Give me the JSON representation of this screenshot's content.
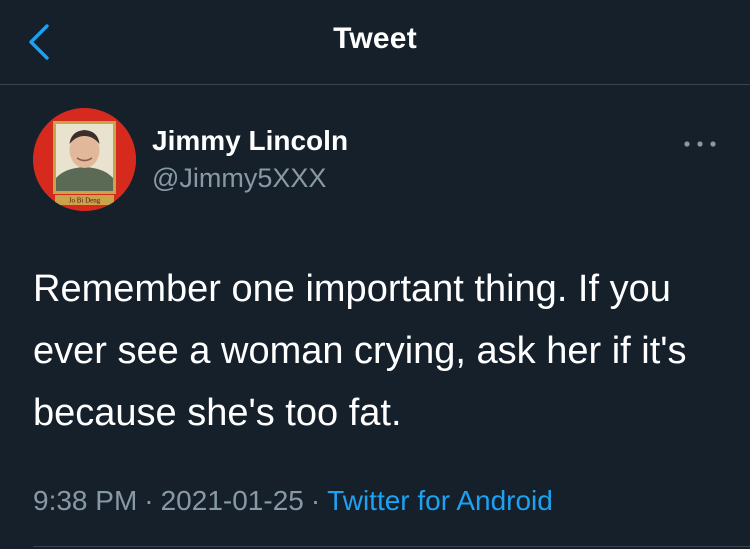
{
  "header": {
    "title": "Tweet",
    "back_icon": "chevron-left-icon"
  },
  "tweet": {
    "author": {
      "display_name": "Jimmy Lincoln",
      "handle": "@Jimmy5XXX",
      "avatar_caption": "Jo Bi Deng"
    },
    "text": "Remember one important thing. If you ever see a woman crying, ask her if it's because she's too fat.",
    "time": "9:38 PM",
    "date": "2021-01-25",
    "separator": "·",
    "source": "Twitter for Android"
  },
  "colors": {
    "background": "#15202b",
    "divider": "#38444d",
    "primary_text": "#ffffff",
    "secondary_text": "#8899a6",
    "accent": "#1da1f2",
    "avatar_bg": "#d52a1d"
  }
}
